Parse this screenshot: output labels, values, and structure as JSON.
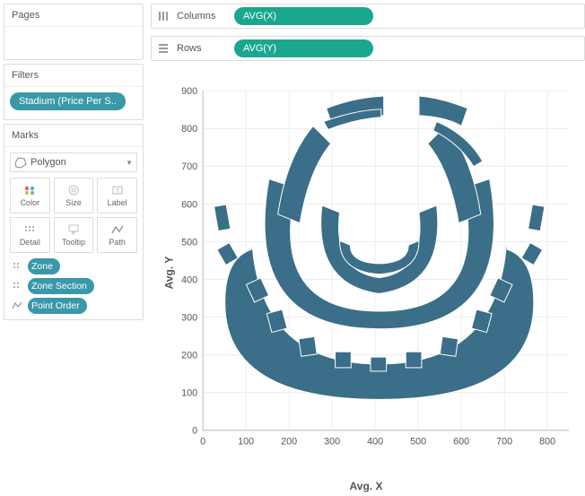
{
  "panels": {
    "pages": "Pages",
    "filters": "Filters",
    "marks": "Marks"
  },
  "filter_pill": "Stadium (Price Per S..",
  "mark_type": "Polygon",
  "mark_buttons": [
    "Color",
    "Size",
    "Label",
    "Detail",
    "Tooltip",
    "Path"
  ],
  "mark_fields": [
    {
      "icon": "detail",
      "label": "Zone"
    },
    {
      "icon": "detail",
      "label": "Zone Section"
    },
    {
      "icon": "path",
      "label": "Point Order"
    }
  ],
  "shelves": {
    "columns_label": "Columns",
    "rows_label": "Rows",
    "columns_pill": "AVG(X)",
    "rows_pill": "AVG(Y)"
  },
  "chart_data": {
    "type": "scatter",
    "xlabel": "Avg. X",
    "ylabel": "Avg. Y",
    "xlim": [
      0,
      850
    ],
    "ylim": [
      0,
      900
    ],
    "x_ticks": [
      0,
      100,
      200,
      300,
      400,
      500,
      600,
      700,
      800
    ],
    "y_ticks": [
      0,
      100,
      200,
      300,
      400,
      500,
      600,
      700,
      800,
      900
    ],
    "note": "Polygon mark showing stadium seating zones; bounding extent approx x:[150,850] y:[100,900]",
    "series": [
      {
        "name": "Zone / Zone Section polygons",
        "x": [],
        "y": []
      }
    ]
  },
  "colors": {
    "pill": "#3a98a8",
    "pill_green": "#1aa78e",
    "polygon": "#3b6e88"
  }
}
